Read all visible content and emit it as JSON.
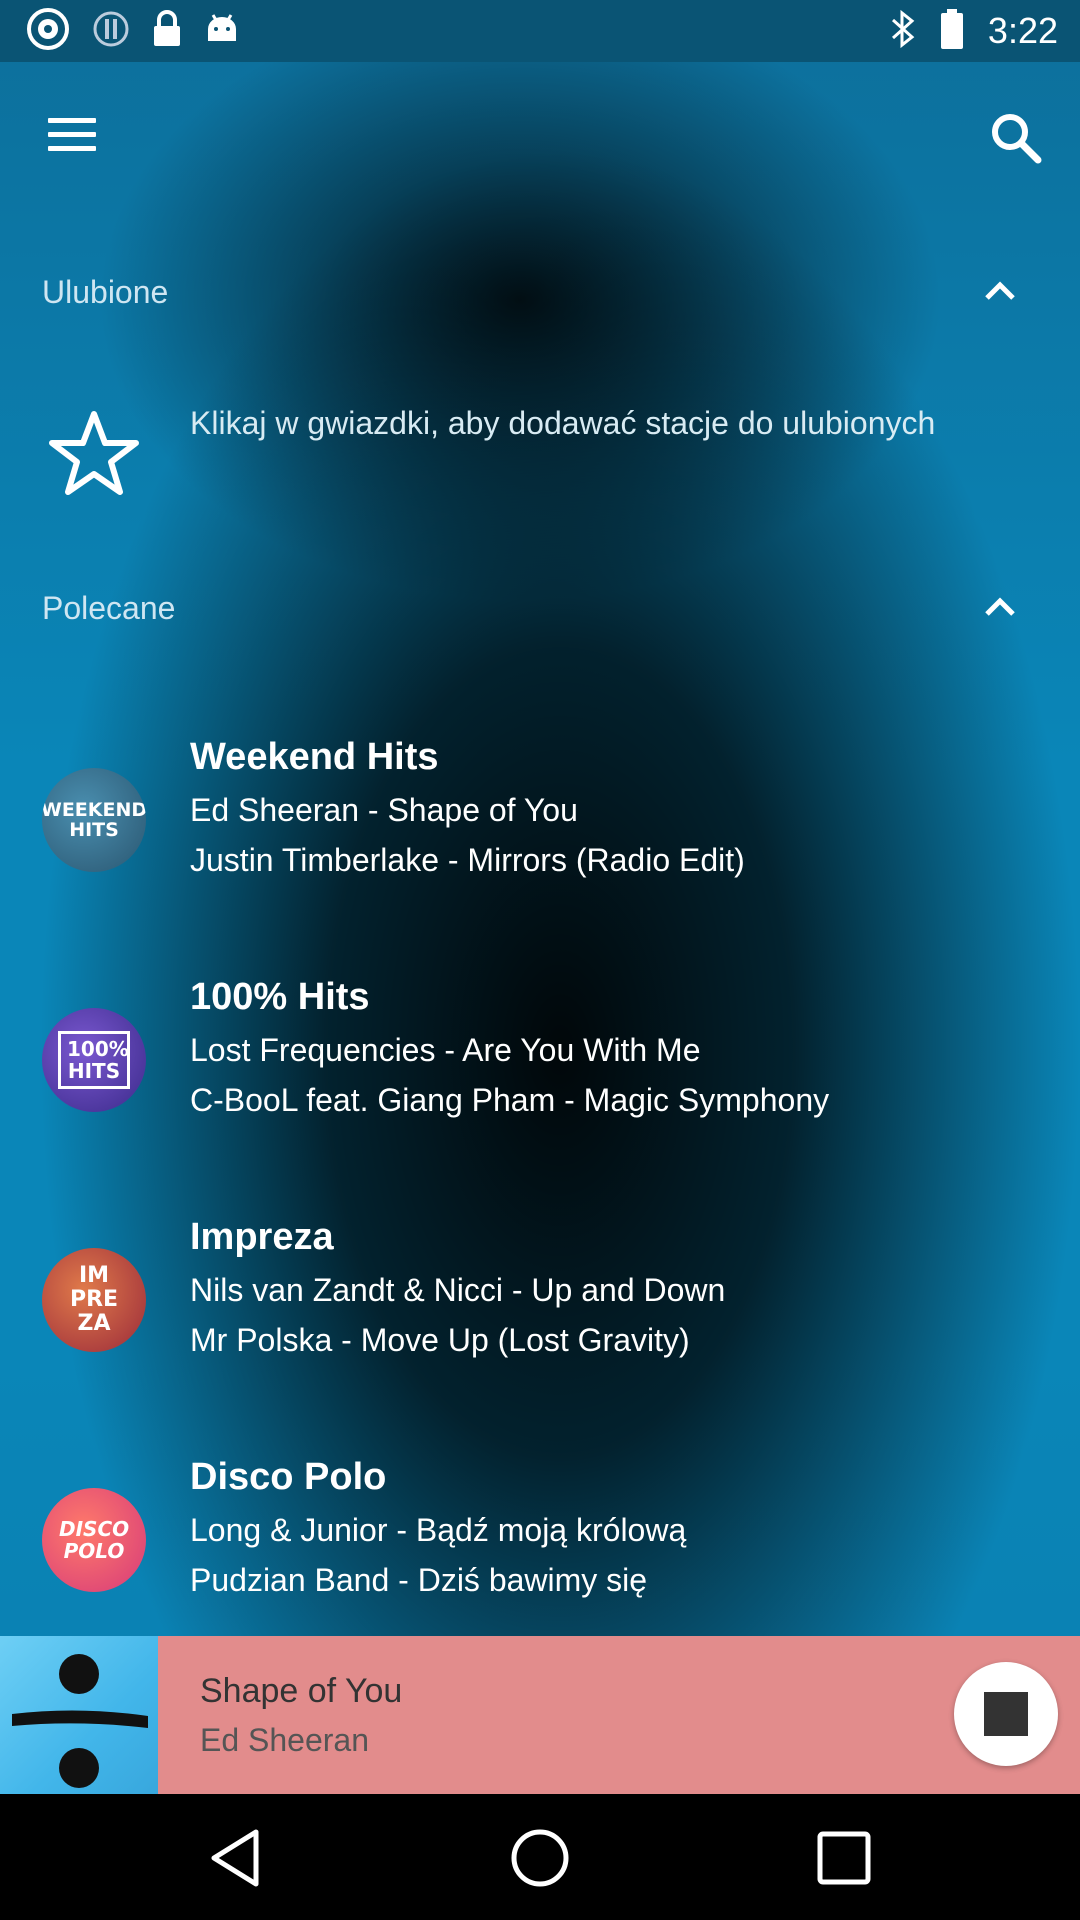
{
  "status_bar": {
    "time": "3:22",
    "icons": [
      "radio-icon",
      "sync-icon",
      "lock-icon",
      "android-icon",
      "bluetooth-icon",
      "battery-icon"
    ]
  },
  "toolbar": {
    "menu_icon": "menu-icon",
    "search_icon": "search-icon"
  },
  "favorites": {
    "title": "Ulubione",
    "hint": "Klikaj w gwiazdki, aby dodawać stacje do ulubionych",
    "icon": "star-outline-icon"
  },
  "recommended": {
    "title": "Polecane",
    "stations": [
      {
        "name": "Weekend Hits",
        "track1": "Ed Sheeran - Shape of You",
        "track2": "Justin Timberlake - Mirrors (Radio Edit)",
        "logo_text": "WEEKEND HITS",
        "logo_color": "#3a6f8d"
      },
      {
        "name": "100% Hits",
        "track1": "Lost Frequencies - Are You With Me",
        "track2": "C-BooL feat. Giang Pham - Magic Symphony",
        "logo_text": "100% HITS",
        "logo_color": "#5b3fa6"
      },
      {
        "name": "Impreza",
        "track1": "Nils van Zandt & Nicci - Up and Down",
        "track2": "Mr Polska - Move Up (Lost Gravity)",
        "logo_text": "IM PRE ZA",
        "logo_color": "#c24a3a"
      },
      {
        "name": "Disco Polo",
        "track1": "Long & Junior - Bądź moją królową",
        "track2": "Pudzian Band - Dziś bawimy się",
        "logo_text": "DISCO POLO",
        "logo_color": "#e0407a"
      }
    ]
  },
  "player": {
    "title": "Shape of You",
    "artist": "Ed Sheeran",
    "stop_icon": "stop-icon",
    "background": "#e28c8c"
  },
  "nav_bar": {
    "icons": [
      "back-icon",
      "home-icon",
      "recents-icon"
    ]
  }
}
